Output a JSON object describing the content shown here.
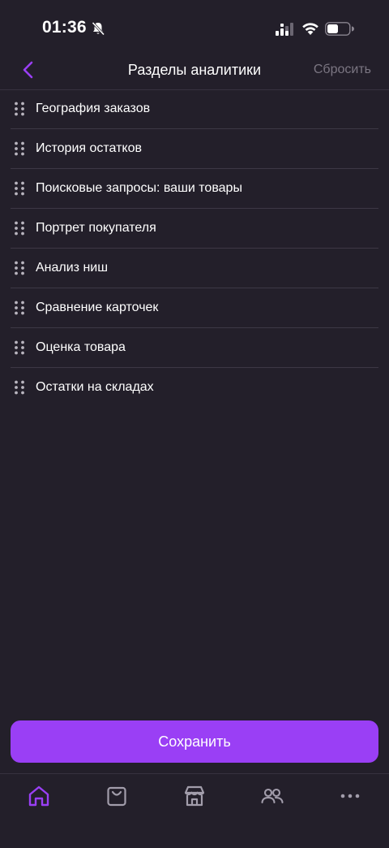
{
  "status_bar": {
    "time": "01:36"
  },
  "header": {
    "title": "Разделы аналитики",
    "reset_label": "Сбросить"
  },
  "sections": [
    {
      "label": "География заказов"
    },
    {
      "label": "История остатков"
    },
    {
      "label": "Поисковые запросы: ваши товары"
    },
    {
      "label": "Портрет покупателя"
    },
    {
      "label": "Анализ ниш"
    },
    {
      "label": "Сравнение карточек"
    },
    {
      "label": "Оценка товара"
    },
    {
      "label": "Остатки на складах"
    }
  ],
  "save_label": "Сохранить",
  "bottom_nav": {
    "items": [
      "home-icon",
      "shopping-bag-icon",
      "store-icon",
      "users-icon",
      "more-icon"
    ],
    "active": "home-icon"
  },
  "colors": {
    "background": "#231f2a",
    "accent": "#9a3ff5",
    "muted": "#7b7682",
    "divider": "#3d3845"
  }
}
